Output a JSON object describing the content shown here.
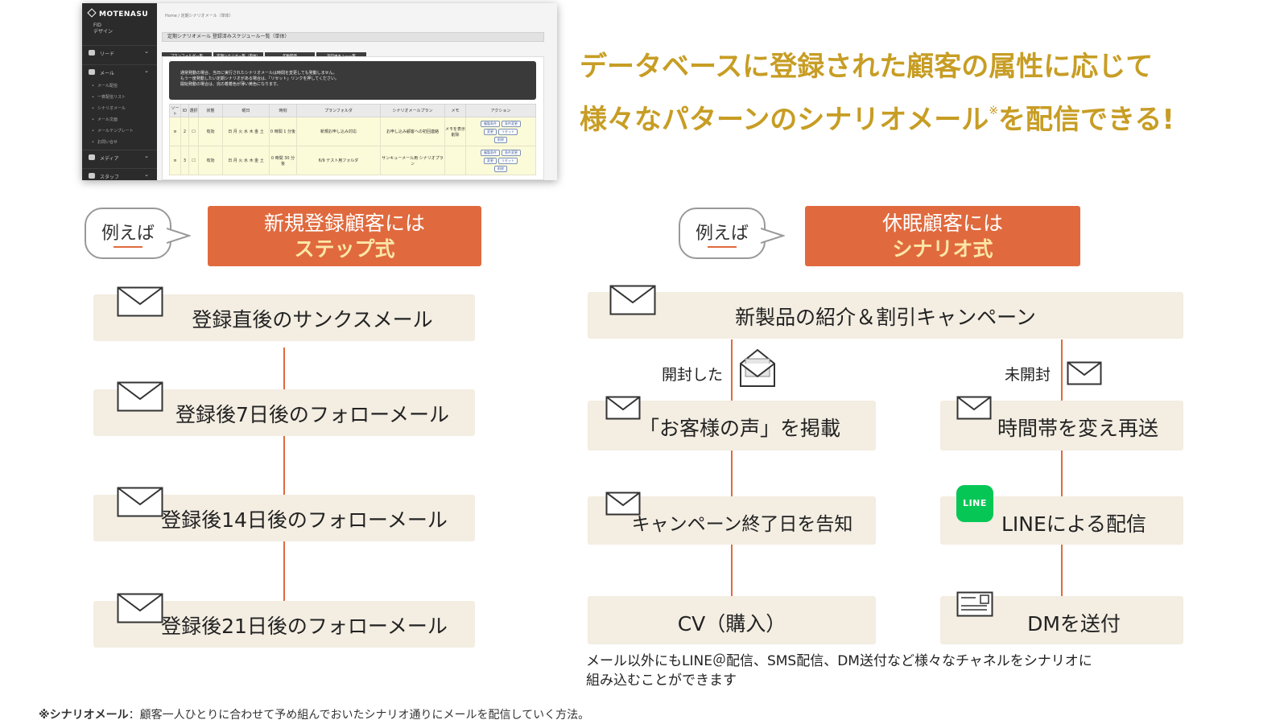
{
  "screenshot": {
    "brand": "MOTENASU",
    "account": [
      "FID",
      "デザイン"
    ],
    "nav": [
      {
        "label": "リード",
        "chevron": "⌄"
      },
      {
        "label": "メール",
        "chevron": "⌄"
      },
      {
        "label": "メディア",
        "chevron": "⌄"
      },
      {
        "label": "スタッフ",
        "chevron": "⌄"
      }
    ],
    "mail_sub_items": [
      "メール配信",
      "一斉配信リスト",
      "シナリオメール",
      "メール文面",
      "メールテンプレート",
      "お問い合せ"
    ],
    "breadcrumb": "Home  /  定期シナリオメール（単体）",
    "page_title": "定期シナリオメール 登録済みスケジュール一覧（単体）",
    "tabs": [
      "プランフォルダ一覧",
      "定期シナリオ一覧（単体）",
      "年動開発",
      "実行中キュー一覧"
    ],
    "notice": [
      "通常発動の場合、当日に実行されたシナリオメールは時間を変更しても発動しません。",
      "もう一度発動したい定期シナリオがある場合は、「リセット」リンクを押してください。",
      "開始発動の場合は、完の着着色が薄い黄色になります。"
    ],
    "table_headers": [
      "ソート",
      "ID",
      "選択",
      "状態",
      "曜日",
      "時刻",
      "プランフォルダ",
      "シナリオメールプラン",
      "メモ",
      "アクション"
    ],
    "table_rows": [
      {
        "id": "2",
        "state": "有効",
        "days": "日 月 火 水 木 金 土",
        "time": "0 時間 1 分後",
        "folder": "新規お申し込み対応",
        "plan": "お申し込み顧客への初回連絡",
        "memo": "メモを表示 削除",
        "actions": [
          "複製条件",
          "条件変更",
          "変更",
          "リセット",
          "削除"
        ]
      },
      {
        "id": "3",
        "state": "有効",
        "days": "日 月 火 水 木 金 土",
        "time": "0 時間 30 分後",
        "folder": "6/9 テスト用フォルダ",
        "plan": "サンキューメール用 シナリオプラン",
        "memo": "",
        "actions": [
          "複製条件",
          "条件変更",
          "変更",
          "リセット",
          "削除"
        ]
      }
    ]
  },
  "headline": {
    "line1": "データベースに登録された顧客の属性に応じて",
    "line2": "様々なパターンのシナリオメール",
    "note_mark": "※",
    "line2_end": "を配信できる!"
  },
  "left": {
    "bubble": "例えば",
    "header_line1": "新規登録顧客には",
    "header_line2": "ステップ式",
    "steps": [
      "登録直後のサンクスメール",
      "登録後7日後のフォローメール",
      "登録後14日後のフォローメール",
      "登録後21日後のフォローメール"
    ]
  },
  "right": {
    "bubble": "例えば",
    "header_line1": "休眠顧客には",
    "header_line2": "シナリオ式",
    "top": "新製品の紹介＆割引キャンペーン",
    "opened_label": "開封した",
    "unopened_label": "未開封",
    "opened_branch": [
      "「お客様の声」を掲載",
      "キャンペーン終了日を告知",
      "CV（購入）"
    ],
    "unopened_branch": [
      "時間帯を変え再送",
      "LINEによる配信",
      "DMを送付"
    ],
    "line_icon": "LINE",
    "note_line1": "メール以外にもLINE＠配信、SMS配信、DM送付など様々なチャネルをシナリオに",
    "note_line2": "組み込むことができます"
  },
  "footnote": {
    "term": "※シナリオメール",
    "text": "：顧客一人ひとりに合わせて予め組んでおいたシナリオ通りにメールを配信していく方法。"
  },
  "colors": {
    "accent": "#e06a3e",
    "headline": "#c79d24",
    "box_bg": "#f3ede2",
    "line_green": "#06c755"
  }
}
